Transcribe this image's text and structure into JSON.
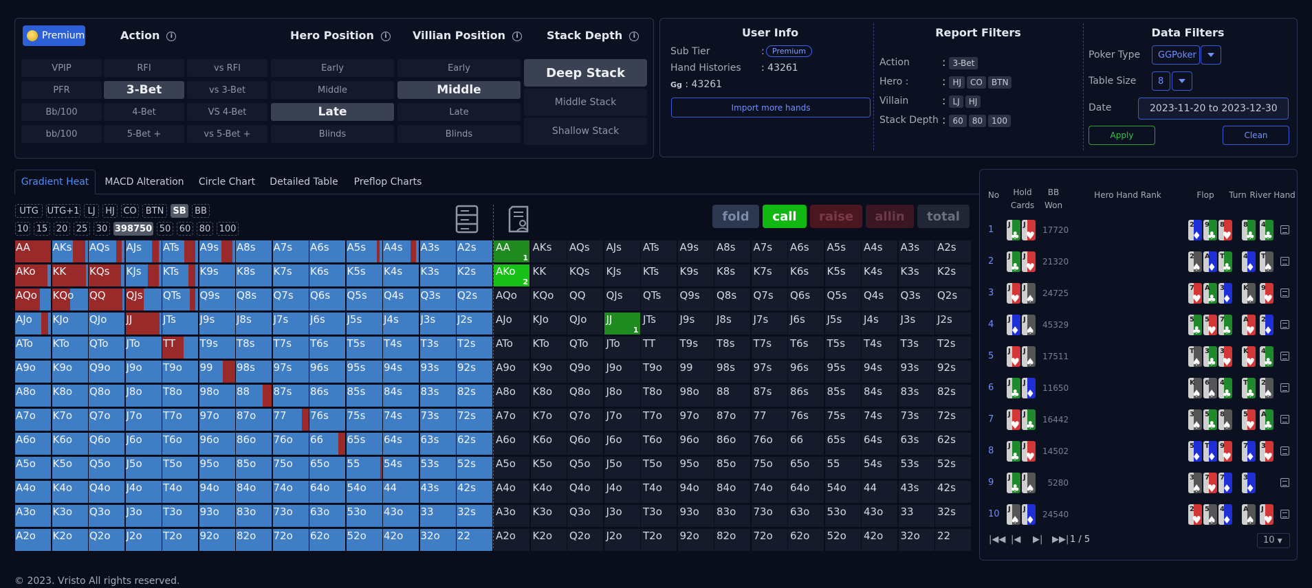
{
  "premium_button": "Premium",
  "filter_panel": {
    "headers": {
      "action": "Action",
      "hero_position": "Hero Position",
      "villian_position": "Villian Position",
      "stack_depth": "Stack Depth"
    },
    "action_buttons": [
      "VPIP",
      "RFI",
      "vs RFI",
      "PFR",
      "3-Bet",
      "vs 3-Bet",
      "Bb/100",
      "4-Bet",
      "VS 4-Bet",
      "bb/100",
      "5-Bet +",
      "vs 5-Bet +"
    ],
    "selected_action": "3-Bet",
    "hero_positions": [
      "Early",
      "Middle",
      "Late",
      "Blinds"
    ],
    "selected_hero": "Late",
    "villian_positions": [
      "Early",
      "Middle",
      "Late",
      "Blinds"
    ],
    "selected_villian": "Middle",
    "stack_depths": [
      "Deep Stack",
      "Middle Stack",
      "Shallow Stack"
    ],
    "selected_stack": "Deep Stack"
  },
  "user_info": {
    "title": "User Info",
    "sub_tier_label": "Sub Tier",
    "sub_tier": "Premium",
    "hand_histories_label": "Hand Histories",
    "hand_histories": "43261",
    "gg_label": "Gg",
    "gg_value": "43261",
    "import_button": "Import more hands"
  },
  "report_filters": {
    "title": "Report Filters",
    "action_label": "Action",
    "hero_label": "Hero :",
    "villain_label": "Villain",
    "stack_depth_label": "Stack Depth",
    "action": [
      "3-Bet"
    ],
    "hero": [
      "HJ",
      "CO",
      "BTN"
    ],
    "villain": [
      "LJ",
      "HJ"
    ],
    "stack_depth": [
      "60",
      "80",
      "100"
    ]
  },
  "data_filters": {
    "title": "Data Filters",
    "poker_type_label": "Poker Type",
    "poker_type": "GGPoker",
    "table_size_label": "Table Size",
    "table_size": "8",
    "date_label": "Date",
    "date": "2023-11-20 to 2023-12-30",
    "apply_button": "Apply",
    "clean_button": "Clean"
  },
  "tabs": [
    "Gradient Heat",
    "MACD Alteration",
    "Circle Chart",
    "Detailed Table",
    "Preflop Charts"
  ],
  "active_tab": "Gradient Heat",
  "position_chips": [
    "UTG",
    "UTG+1",
    "LJ",
    "HJ",
    "CO",
    "BTN",
    "SB",
    "BB"
  ],
  "selected_position": "SB",
  "stack_chips": [
    "10",
    "15",
    "20",
    "25",
    "30",
    "398750",
    "50",
    "60",
    "80",
    "100"
  ],
  "selected_stack_chip": "398750",
  "action_filter_buttons": {
    "fold": "fold",
    "call": "call",
    "raise": "raise",
    "allin": "allin",
    "total": "total"
  },
  "hand_matrix": [
    [
      "AA",
      "AKs",
      "AQs",
      "AJs",
      "ATs",
      "A9s",
      "A8s",
      "A7s",
      "A6s",
      "A5s",
      "A4s",
      "A3s",
      "A2s"
    ],
    [
      "AKo",
      "KK",
      "KQs",
      "KJs",
      "KTs",
      "K9s",
      "K8s",
      "K7s",
      "K6s",
      "K5s",
      "K4s",
      "K3s",
      "K2s"
    ],
    [
      "AQo",
      "KQo",
      "QQ",
      "QJs",
      "QTs",
      "Q9s",
      "Q8s",
      "Q7s",
      "Q6s",
      "Q5s",
      "Q4s",
      "Q3s",
      "Q2s"
    ],
    [
      "AJo",
      "KJo",
      "QJo",
      "JJ",
      "JTs",
      "J9s",
      "J8s",
      "J7s",
      "J6s",
      "J5s",
      "J4s",
      "J3s",
      "J2s"
    ],
    [
      "ATo",
      "KTo",
      "QTo",
      "JTo",
      "TT",
      "T9s",
      "T8s",
      "T7s",
      "T6s",
      "T5s",
      "T4s",
      "T3s",
      "T2s"
    ],
    [
      "A9o",
      "K9o",
      "Q9o",
      "J9o",
      "T9o",
      "99",
      "98s",
      "97s",
      "96s",
      "95s",
      "94s",
      "93s",
      "92s"
    ],
    [
      "A8o",
      "K8o",
      "Q8o",
      "J8o",
      "T8o",
      "98o",
      "88",
      "87s",
      "86s",
      "85s",
      "84s",
      "83s",
      "82s"
    ],
    [
      "A7o",
      "K7o",
      "Q7o",
      "J7o",
      "T7o",
      "97o",
      "87o",
      "77",
      "76s",
      "75s",
      "74s",
      "73s",
      "72s"
    ],
    [
      "A6o",
      "K6o",
      "Q6o",
      "J6o",
      "T6o",
      "96o",
      "86o",
      "76o",
      "66",
      "65s",
      "64s",
      "63s",
      "62s"
    ],
    [
      "A5o",
      "K5o",
      "Q5o",
      "J5o",
      "T5o",
      "95o",
      "85o",
      "75o",
      "65o",
      "55",
      "54s",
      "53s",
      "52s"
    ],
    [
      "A4o",
      "K4o",
      "Q4o",
      "J4o",
      "T4o",
      "94o",
      "84o",
      "74o",
      "64o",
      "54o",
      "44",
      "43s",
      "42s"
    ],
    [
      "A3o",
      "K3o",
      "Q3o",
      "J3o",
      "T3o",
      "93o",
      "83o",
      "73o",
      "63o",
      "53o",
      "43o",
      "33",
      "32s"
    ],
    [
      "A2o",
      "K2o",
      "Q2o",
      "J2o",
      "T2o",
      "92o",
      "82o",
      "72o",
      "62o",
      "52o",
      "42o",
      "32o",
      "22"
    ]
  ],
  "heat_red_fraction": [
    [
      1,
      0.35,
      0.15,
      0.2,
      0.3,
      0.3,
      0,
      0,
      0,
      0.08,
      0.15,
      0,
      0
    ],
    [
      0.9,
      0.95,
      0.9,
      0.3,
      0.2,
      0,
      0,
      0,
      0,
      0,
      0,
      0,
      0
    ],
    [
      0.7,
      0.5,
      0.95,
      0.5,
      0.15,
      0,
      0,
      0,
      0,
      0,
      0,
      0,
      0
    ],
    [
      0.2,
      0,
      0,
      0.95,
      0,
      0,
      0,
      0,
      0,
      0,
      0,
      0,
      0
    ],
    [
      0,
      0,
      0,
      0,
      0.6,
      0,
      0,
      0,
      0,
      0,
      0,
      0,
      0
    ],
    [
      0,
      0,
      0,
      0,
      0,
      0.35,
      0,
      0,
      0,
      0,
      0,
      0,
      0
    ],
    [
      0,
      0,
      0,
      0,
      0,
      0,
      0.25,
      0,
      0,
      0,
      0,
      0,
      0
    ],
    [
      0,
      0,
      0,
      0,
      0,
      0,
      0,
      0.2,
      0,
      0,
      0,
      0,
      0
    ],
    [
      0,
      0,
      0,
      0,
      0,
      0,
      0,
      0,
      0.2,
      0,
      0,
      0,
      0
    ],
    [
      0,
      0,
      0,
      0,
      0,
      0,
      0,
      0,
      0,
      0.05,
      0,
      0,
      0
    ],
    [
      0,
      0,
      0,
      0,
      0,
      0,
      0,
      0,
      0,
      0,
      0,
      0,
      0
    ],
    [
      0,
      0,
      0,
      0,
      0,
      0,
      0,
      0,
      0,
      0,
      0,
      0,
      0
    ],
    [
      0,
      0,
      0,
      0,
      0,
      0,
      0,
      0,
      0,
      0,
      0,
      0,
      0
    ]
  ],
  "detail_counts": [
    {
      "hand": "AA",
      "count": "1"
    },
    {
      "hand": "AKo",
      "count": "2"
    },
    {
      "hand": "JJ",
      "count": "1"
    }
  ],
  "hands_table": {
    "headers": {
      "no": "No",
      "hole_cards": "Hold Cards",
      "bb_won": "BB Won",
      "rank": "Hero Hand Rank",
      "flop": "Flop",
      "turn": "Turn",
      "river": "River",
      "hand": "Hand"
    },
    "rows": [
      {
        "no": "1",
        "hole": [
          [
            "J",
            "c"
          ],
          [
            "J",
            "h"
          ]
        ],
        "won": "17720",
        "flop": [
          [
            "2",
            "d"
          ],
          [
            "9",
            "c"
          ],
          [
            "8",
            "h"
          ]
        ],
        "turn": [
          "8",
          "c"
        ],
        "river": [
          "4",
          "c"
        ]
      },
      {
        "no": "2",
        "hole": [
          [
            "J",
            "c"
          ],
          [
            "J",
            "h"
          ]
        ],
        "won": "21320",
        "flop": [
          [
            "2",
            "s"
          ],
          [
            "A",
            "d"
          ],
          [
            "T",
            "c"
          ]
        ],
        "turn": [
          "4",
          "d"
        ],
        "river": [
          "T",
          "s"
        ]
      },
      {
        "no": "3",
        "hole": [
          [
            "J",
            "h"
          ],
          [
            "J",
            "s"
          ]
        ],
        "won": "24725",
        "flop": [
          [
            "7",
            "h"
          ],
          [
            "A",
            "c"
          ],
          [
            "3",
            "d"
          ]
        ],
        "turn": [
          "K",
          "s"
        ],
        "river": [
          "9",
          "h"
        ]
      },
      {
        "no": "4",
        "hole": [
          [
            "J",
            "d"
          ],
          [
            "J",
            "s"
          ]
        ],
        "won": "45329",
        "flop": [
          [
            "5",
            "c"
          ],
          [
            "5",
            "h"
          ],
          [
            "7",
            "c"
          ]
        ],
        "turn": [
          "A",
          "h"
        ],
        "river": [
          "2",
          "d"
        ]
      },
      {
        "no": "5",
        "hole": [
          [
            "J",
            "h"
          ],
          [
            "J",
            "s"
          ]
        ],
        "won": "17511",
        "flop": [
          [
            "T",
            "s"
          ],
          [
            "3",
            "c"
          ],
          [
            "3",
            "h"
          ]
        ],
        "turn": [
          "K",
          "h"
        ],
        "river": [
          "4",
          "c"
        ]
      },
      {
        "no": "6",
        "hole": [
          [
            "J",
            "c"
          ],
          [
            "J",
            "d"
          ]
        ],
        "won": "11650",
        "flop": [
          [
            "K",
            "s"
          ],
          [
            "6",
            "s"
          ],
          [
            "4",
            "c"
          ]
        ],
        "turn": [
          "T",
          "c"
        ],
        "river": [
          "2",
          "s"
        ]
      },
      {
        "no": "7",
        "hole": [
          [
            "J",
            "h"
          ],
          [
            "J",
            "c"
          ]
        ],
        "won": "16442",
        "flop": [
          [
            "3",
            "s"
          ],
          [
            "5",
            "c"
          ],
          [
            "8",
            "s"
          ]
        ],
        "turn": [
          "5",
          "h"
        ],
        "river": [
          "A",
          "c"
        ]
      },
      {
        "no": "8",
        "hole": [
          [
            "J",
            "c"
          ],
          [
            "J",
            "h"
          ]
        ],
        "won": "14502",
        "flop": [
          [
            "5",
            "d"
          ],
          [
            "T",
            "d"
          ],
          [
            "9",
            "h"
          ]
        ],
        "turn": [
          "7",
          "d"
        ],
        "river": [
          "3",
          "h"
        ]
      },
      {
        "no": "9",
        "hole": [
          [
            "J",
            "c"
          ],
          [
            "J",
            "s"
          ]
        ],
        "won": "5280",
        "flop": [
          [
            "3",
            "s"
          ],
          [
            "7",
            "h"
          ],
          [
            "7",
            "d"
          ]
        ],
        "turn": [
          "3",
          "d"
        ],
        "river": null
      },
      {
        "no": "10",
        "hole": [
          [
            "J",
            "s"
          ],
          [
            "J",
            "d"
          ]
        ],
        "won": "24540",
        "flop": [
          [
            "2",
            "h"
          ],
          [
            "5",
            "s"
          ],
          [
            "4",
            "d"
          ]
        ],
        "turn": [
          "A",
          "s"
        ],
        "river": [
          "J",
          "h"
        ]
      }
    ],
    "page": "1 / 5",
    "page_size": "10"
  },
  "footer": "© 2023. Vristo All rights reserved."
}
